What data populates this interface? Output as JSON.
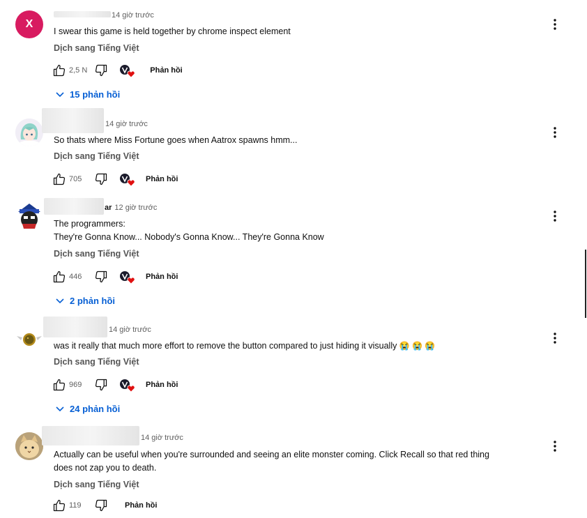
{
  "comments": [
    {
      "avatar_letter": "X",
      "author_tail": "",
      "time": "14 giờ trước",
      "text": "I swear this game is held together by chrome inspect element",
      "translate": "Dịch sang Tiếng Việt",
      "likes": "2,5 N",
      "reply_label": "Phản hồi",
      "replies": "15 phản hồi",
      "creator_heart": true
    },
    {
      "author_tail": "",
      "time": "14 giờ trước",
      "text": "So thats where Miss Fortune goes when Aatrox spawns hmm...",
      "translate": "Dịch sang Tiếng Việt",
      "likes": "705",
      "reply_label": "Phản hồi",
      "creator_heart": true
    },
    {
      "author_tail": "ar",
      "time": "12 giờ trước",
      "text_line1": "The programmers:",
      "text_line2": "They're Gonna Know... Nobody's Gonna Know... They're Gonna Know",
      "translate": "Dịch sang Tiếng Việt",
      "likes": "446",
      "reply_label": "Phản hồi",
      "replies": "2 phản hồi",
      "creator_heart": true
    },
    {
      "author_tail": "",
      "time": "14 giờ trước",
      "text": "was it really that much more effort to remove the button compared to just hiding it visually",
      "emoji": "😭 😭 😭",
      "translate": "Dịch sang Tiếng Việt",
      "likes": "969",
      "reply_label": "Phản hồi",
      "replies": "24 phản hồi",
      "creator_heart": true
    },
    {
      "author_tail": "",
      "time": "14 giờ trước",
      "text_line1": "Actually can be useful when you're surrounded and seeing an elite monster coming. Click Recall so that red thing",
      "text_line2": "does not zap you to death.",
      "translate": "Dịch sang Tiếng Việt",
      "likes": "119",
      "reply_label": "Phản hồi",
      "creator_heart": false
    }
  ],
  "colors": {
    "link_blue": "#065fd4",
    "avatar_x": "#d81b60",
    "heart_red": "#e01010"
  },
  "icons": {
    "like": "thumbs-up-icon",
    "dislike": "thumbs-down-icon",
    "more": "three-dots-vertical-icon",
    "expand": "chevron-down-icon"
  }
}
